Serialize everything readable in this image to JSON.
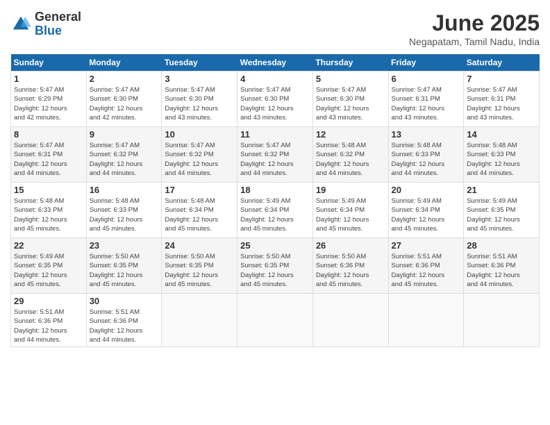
{
  "header": {
    "logo": {
      "general": "General",
      "blue": "Blue"
    },
    "title": "June 2025",
    "location": "Negapatam, Tamil Nadu, India"
  },
  "days_of_week": [
    "Sunday",
    "Monday",
    "Tuesday",
    "Wednesday",
    "Thursday",
    "Friday",
    "Saturday"
  ],
  "weeks": [
    [
      {
        "day": "1",
        "sunrise": "5:47 AM",
        "sunset": "6:29 PM",
        "daylight": "12 hours and 42 minutes."
      },
      {
        "day": "2",
        "sunrise": "5:47 AM",
        "sunset": "6:30 PM",
        "daylight": "12 hours and 42 minutes."
      },
      {
        "day": "3",
        "sunrise": "5:47 AM",
        "sunset": "6:30 PM",
        "daylight": "12 hours and 43 minutes."
      },
      {
        "day": "4",
        "sunrise": "5:47 AM",
        "sunset": "6:30 PM",
        "daylight": "12 hours and 43 minutes."
      },
      {
        "day": "5",
        "sunrise": "5:47 AM",
        "sunset": "6:30 PM",
        "daylight": "12 hours and 43 minutes."
      },
      {
        "day": "6",
        "sunrise": "5:47 AM",
        "sunset": "6:31 PM",
        "daylight": "12 hours and 43 minutes."
      },
      {
        "day": "7",
        "sunrise": "5:47 AM",
        "sunset": "6:31 PM",
        "daylight": "12 hours and 43 minutes."
      }
    ],
    [
      {
        "day": "8",
        "sunrise": "5:47 AM",
        "sunset": "6:31 PM",
        "daylight": "12 hours and 44 minutes."
      },
      {
        "day": "9",
        "sunrise": "5:47 AM",
        "sunset": "6:32 PM",
        "daylight": "12 hours and 44 minutes."
      },
      {
        "day": "10",
        "sunrise": "5:47 AM",
        "sunset": "6:32 PM",
        "daylight": "12 hours and 44 minutes."
      },
      {
        "day": "11",
        "sunrise": "5:47 AM",
        "sunset": "6:32 PM",
        "daylight": "12 hours and 44 minutes."
      },
      {
        "day": "12",
        "sunrise": "5:48 AM",
        "sunset": "6:32 PM",
        "daylight": "12 hours and 44 minutes."
      },
      {
        "day": "13",
        "sunrise": "5:48 AM",
        "sunset": "6:33 PM",
        "daylight": "12 hours and 44 minutes."
      },
      {
        "day": "14",
        "sunrise": "5:48 AM",
        "sunset": "6:33 PM",
        "daylight": "12 hours and 44 minutes."
      }
    ],
    [
      {
        "day": "15",
        "sunrise": "5:48 AM",
        "sunset": "6:33 PM",
        "daylight": "12 hours and 45 minutes."
      },
      {
        "day": "16",
        "sunrise": "5:48 AM",
        "sunset": "6:33 PM",
        "daylight": "12 hours and 45 minutes."
      },
      {
        "day": "17",
        "sunrise": "5:48 AM",
        "sunset": "6:34 PM",
        "daylight": "12 hours and 45 minutes."
      },
      {
        "day": "18",
        "sunrise": "5:49 AM",
        "sunset": "6:34 PM",
        "daylight": "12 hours and 45 minutes."
      },
      {
        "day": "19",
        "sunrise": "5:49 AM",
        "sunset": "6:34 PM",
        "daylight": "12 hours and 45 minutes."
      },
      {
        "day": "20",
        "sunrise": "5:49 AM",
        "sunset": "6:34 PM",
        "daylight": "12 hours and 45 minutes."
      },
      {
        "day": "21",
        "sunrise": "5:49 AM",
        "sunset": "6:35 PM",
        "daylight": "12 hours and 45 minutes."
      }
    ],
    [
      {
        "day": "22",
        "sunrise": "5:49 AM",
        "sunset": "6:35 PM",
        "daylight": "12 hours and 45 minutes."
      },
      {
        "day": "23",
        "sunrise": "5:50 AM",
        "sunset": "6:35 PM",
        "daylight": "12 hours and 45 minutes."
      },
      {
        "day": "24",
        "sunrise": "5:50 AM",
        "sunset": "6:35 PM",
        "daylight": "12 hours and 45 minutes."
      },
      {
        "day": "25",
        "sunrise": "5:50 AM",
        "sunset": "6:35 PM",
        "daylight": "12 hours and 45 minutes."
      },
      {
        "day": "26",
        "sunrise": "5:50 AM",
        "sunset": "6:36 PM",
        "daylight": "12 hours and 45 minutes."
      },
      {
        "day": "27",
        "sunrise": "5:51 AM",
        "sunset": "6:36 PM",
        "daylight": "12 hours and 45 minutes."
      },
      {
        "day": "28",
        "sunrise": "5:51 AM",
        "sunset": "6:36 PM",
        "daylight": "12 hours and 44 minutes."
      }
    ],
    [
      {
        "day": "29",
        "sunrise": "5:51 AM",
        "sunset": "6:36 PM",
        "daylight": "12 hours and 44 minutes."
      },
      {
        "day": "30",
        "sunrise": "5:51 AM",
        "sunset": "6:36 PM",
        "daylight": "12 hours and 44 minutes."
      },
      null,
      null,
      null,
      null,
      null
    ]
  ],
  "labels": {
    "sunrise": "Sunrise:",
    "sunset": "Sunset:",
    "daylight": "Daylight:"
  }
}
